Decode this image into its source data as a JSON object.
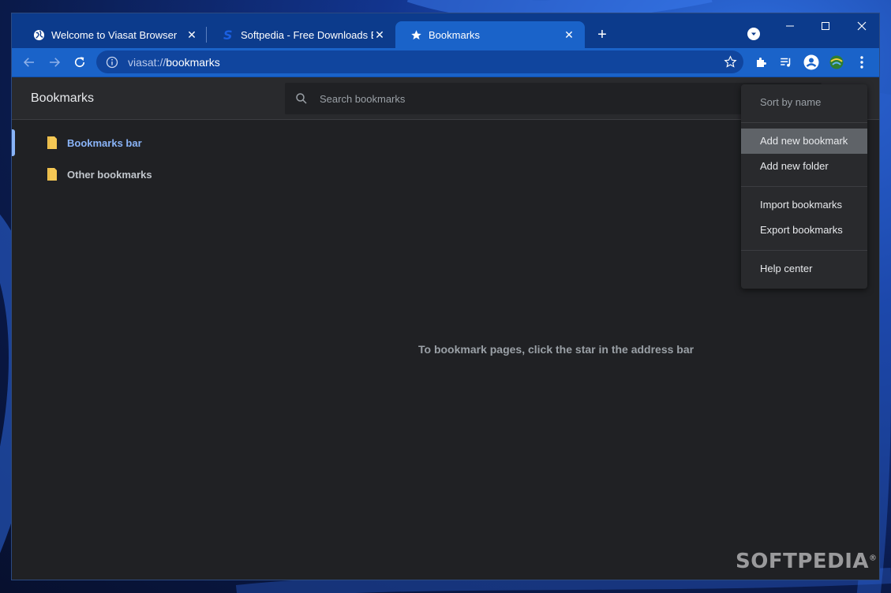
{
  "tabs": [
    {
      "title": "Welcome to Viasat Browser",
      "icon": "globe-icon",
      "active": false
    },
    {
      "title": "Softpedia - Free Downloads Ency",
      "icon": "softpedia-icon",
      "active": false
    },
    {
      "title": "Bookmarks",
      "icon": "star-icon",
      "active": true
    }
  ],
  "address": {
    "scheme": "viasat://",
    "path": "bookmarks"
  },
  "page": {
    "title": "Bookmarks",
    "search_placeholder": "Search bookmarks",
    "empty_message": "To bookmark pages, click the star in the address bar"
  },
  "folders": [
    {
      "label": "Bookmarks bar",
      "selected": true
    },
    {
      "label": "Other bookmarks",
      "selected": false
    }
  ],
  "menu": {
    "sort_by_name": "Sort by name",
    "add_new_bookmark": "Add new bookmark",
    "add_new_folder": "Add new folder",
    "import_bookmarks": "Import bookmarks",
    "export_bookmarks": "Export bookmarks",
    "help_center": "Help center"
  },
  "watermark": "SOFTPEDIA",
  "colors": {
    "titlebar": "#0c3b8c",
    "toolbar": "#1a63c9",
    "accent": "#8ab4f8",
    "folder": "#f6c955",
    "background": "#202124"
  }
}
